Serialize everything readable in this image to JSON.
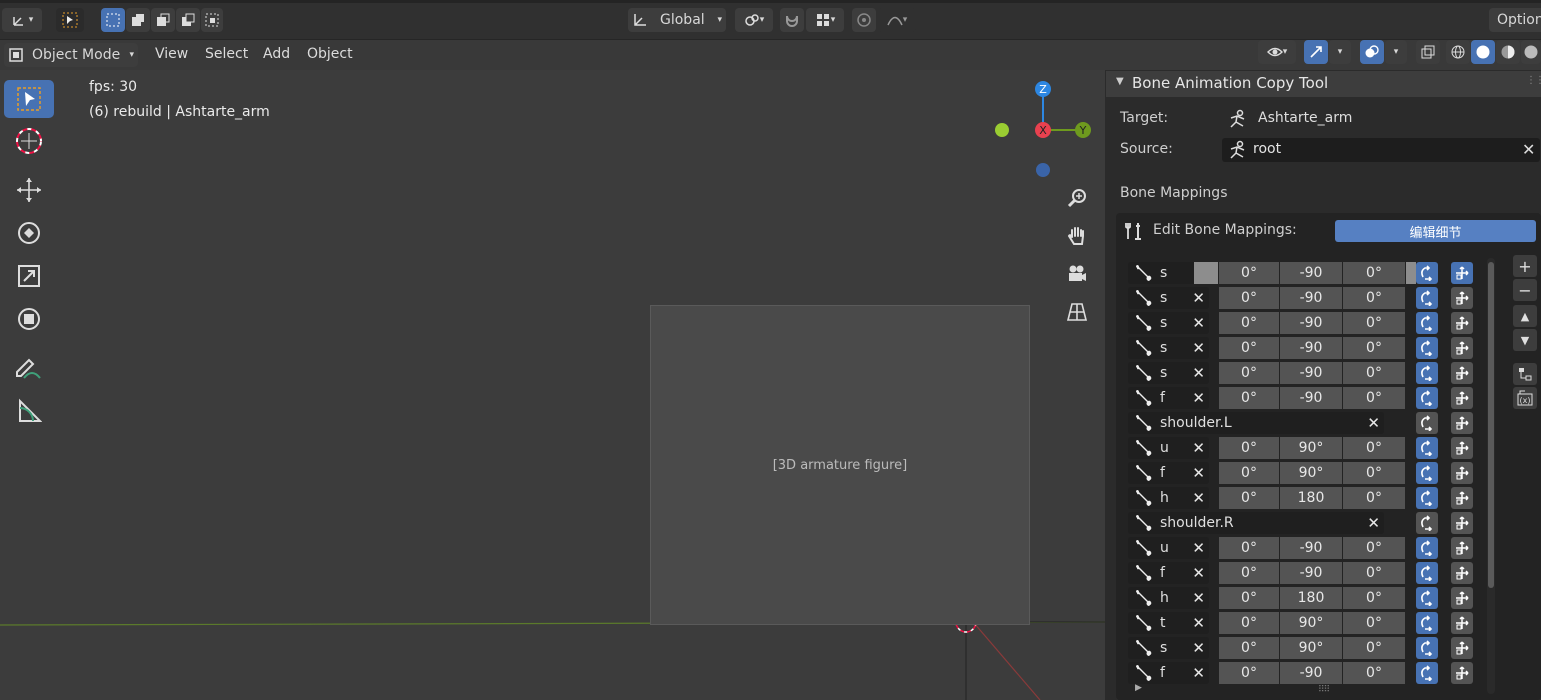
{
  "topbar": {
    "orientation_label": "Global",
    "options_label": "Option"
  },
  "viewport_header": {
    "mode_label": "Object Mode",
    "menus": [
      "View",
      "Select",
      "Add",
      "Object"
    ]
  },
  "overlay": {
    "fps": "fps: 30",
    "object_info": "(6) rebuild | Ashtarte_arm"
  },
  "gizmo": {
    "z": "Z",
    "x": "X",
    "y": "Y"
  },
  "scene_placeholder": "[3D armature figure]",
  "panel": {
    "title": "Bone Animation Copy Tool",
    "target_label": "Target:",
    "target_value": "Ashtarte_arm",
    "source_label": "Source:",
    "source_value": "root",
    "mappings_heading": "Bone Mappings",
    "edit_label": "Edit Bone Mappings:",
    "edit_button": "编辑细节"
  },
  "mappings": [
    {
      "bone": "s",
      "a": "0°",
      "b": "-90",
      "c": "0°"
    },
    {
      "bone": "s",
      "a": "0°",
      "b": "-90",
      "c": "0°"
    },
    {
      "bone": "s",
      "a": "0°",
      "b": "-90",
      "c": "0°"
    },
    {
      "bone": "s",
      "a": "0°",
      "b": "-90",
      "c": "0°"
    },
    {
      "bone": "s",
      "a": "0°",
      "b": "-90",
      "c": "0°"
    },
    {
      "bone": "f",
      "a": "0°",
      "b": "-90",
      "c": "0°"
    },
    {
      "bone": "shoulder.L"
    },
    {
      "bone": "u",
      "a": "0°",
      "b": "90°",
      "c": "0°"
    },
    {
      "bone": "f",
      "a": "0°",
      "b": "90°",
      "c": "0°"
    },
    {
      "bone": "h",
      "a": "0°",
      "b": "180",
      "c": "0°"
    },
    {
      "bone": "shoulder.R"
    },
    {
      "bone": "u",
      "a": "0°",
      "b": "-90",
      "c": "0°"
    },
    {
      "bone": "f",
      "a": "0°",
      "b": "-90",
      "c": "0°"
    },
    {
      "bone": "h",
      "a": "0°",
      "b": "180",
      "c": "0°"
    },
    {
      "bone": "t",
      "a": "0°",
      "b": "90°",
      "c": "0°"
    },
    {
      "bone": "s",
      "a": "0°",
      "b": "90°",
      "c": "0°"
    },
    {
      "bone": "f",
      "a": "0°",
      "b": "-90",
      "c": "0°"
    }
  ],
  "colors": {
    "accent": "#4772b3",
    "axis_x": "#e8414f",
    "axis_y": "#6e9a1e",
    "axis_z": "#2d87e2"
  }
}
